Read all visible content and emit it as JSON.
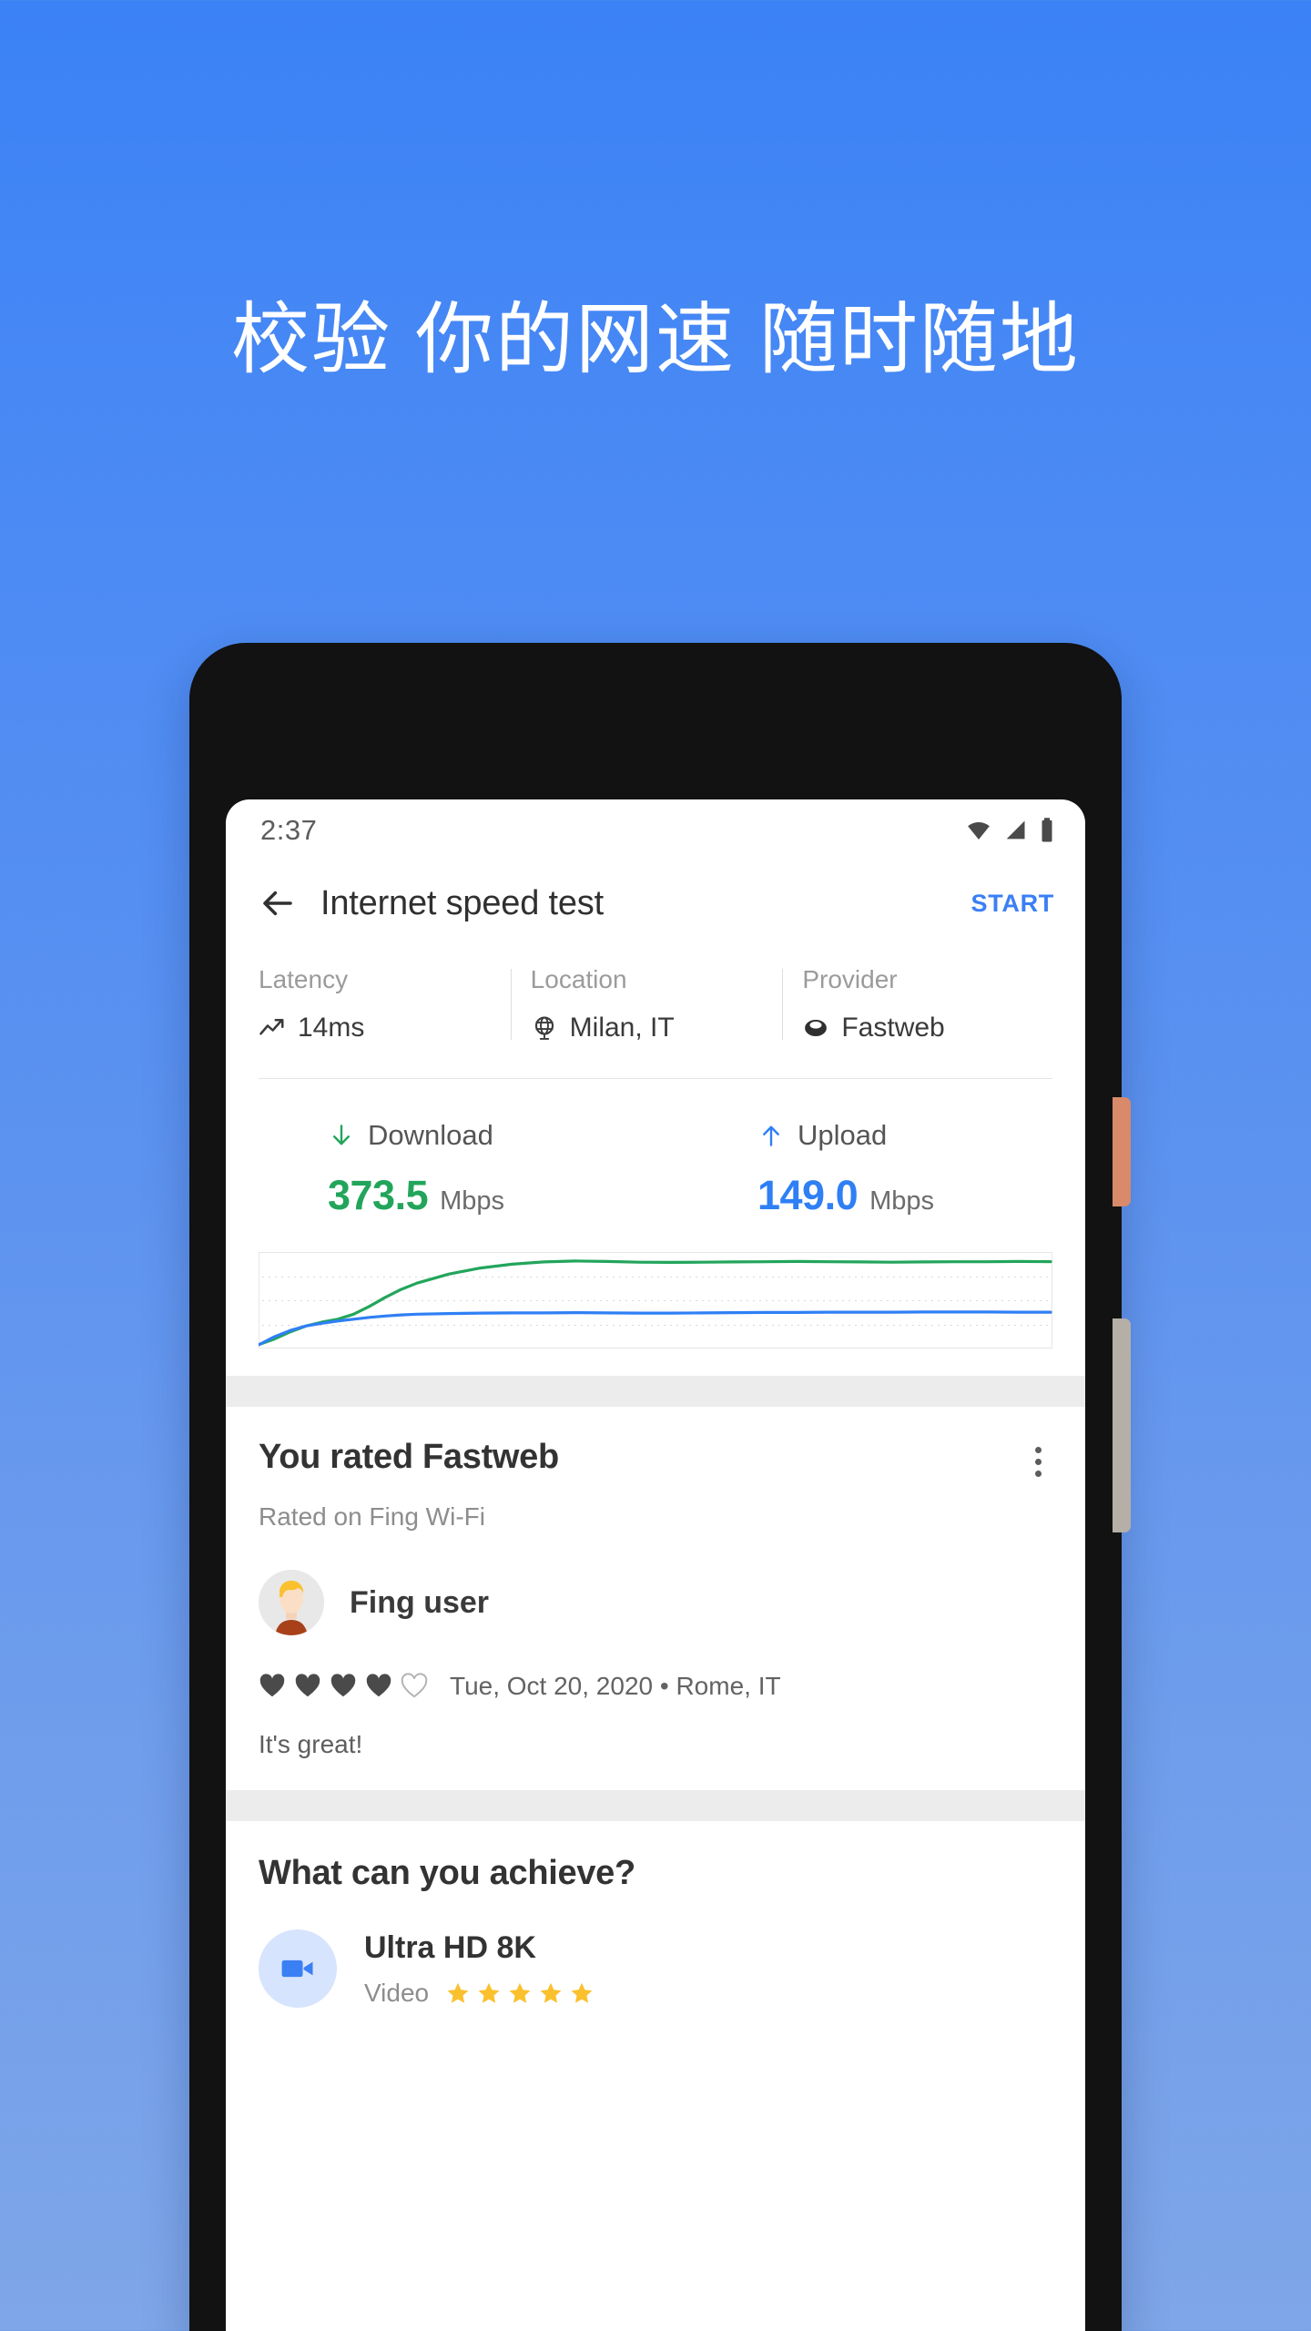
{
  "headline": "校验 你的网速 随时随地",
  "phone": {
    "power_button": "power-button",
    "volume_button": "volume-rocker"
  },
  "status_bar": {
    "time": "2:37",
    "icons": [
      "wifi-icon",
      "cellular-signal-icon",
      "battery-icon"
    ]
  },
  "appbar": {
    "back_icon": "back-arrow-icon",
    "title": "Internet speed test",
    "start_label": "START"
  },
  "info_strip": [
    {
      "label": "Latency",
      "value": "14ms",
      "icon": "trend-up-icon"
    },
    {
      "label": "Location",
      "value": "Milan, IT",
      "icon": "globe-icon"
    },
    {
      "label": "Provider",
      "value": "Fastweb",
      "icon": "server-icon"
    }
  ],
  "speeds": {
    "download": {
      "label": "Download",
      "value": "373.5",
      "unit": "Mbps",
      "color": "#22a55b",
      "icon": "arrow-down-icon"
    },
    "upload": {
      "label": "Upload",
      "value": "149.0",
      "unit": "Mbps",
      "color": "#2f7ff5",
      "icon": "arrow-up-icon"
    }
  },
  "chart_data": {
    "type": "line",
    "title": "",
    "xlabel": "",
    "ylabel": "",
    "grid": true,
    "gridlines": 3,
    "legend": "none",
    "xlim": [
      0,
      100
    ],
    "ylim": [
      0,
      400
    ],
    "series": [
      {
        "name": "Download",
        "color": "#22a55b",
        "unit": "Mbps",
        "x": [
          0,
          2,
          4,
          6,
          8,
          10,
          12,
          14,
          16,
          18,
          20,
          24,
          28,
          32,
          36,
          40,
          44,
          48,
          52,
          56,
          60,
          64,
          68,
          72,
          76,
          80,
          84,
          88,
          92,
          96,
          100
        ],
        "values": [
          5,
          30,
          62,
          88,
          105,
          118,
          140,
          175,
          215,
          250,
          278,
          318,
          345,
          362,
          372,
          376,
          374,
          371,
          370,
          371,
          372,
          373,
          374,
          373,
          372,
          371,
          372,
          373,
          373,
          374,
          373.5
        ]
      },
      {
        "name": "Upload",
        "color": "#2f7ff5",
        "unit": "Mbps",
        "x": [
          0,
          2,
          4,
          6,
          8,
          10,
          12,
          14,
          16,
          18,
          20,
          24,
          28,
          32,
          36,
          40,
          44,
          48,
          52,
          56,
          60,
          64,
          68,
          72,
          76,
          80,
          84,
          88,
          92,
          96,
          100
        ],
        "values": [
          4,
          40,
          68,
          88,
          100,
          110,
          118,
          126,
          132,
          137,
          140,
          143,
          145,
          146,
          146,
          147,
          146,
          145,
          145,
          146,
          147,
          148,
          148,
          149,
          149,
          149,
          150,
          150,
          150,
          149,
          149.0
        ]
      }
    ]
  },
  "rating_card": {
    "title": "You rated Fastweb",
    "subtitle": "Rated on Fing Wi-Fi",
    "menu_icon": "overflow-menu-icon",
    "user_name": "Fing user",
    "avatar": "user-avatar",
    "hearts_filled": 4,
    "hearts_total": 5,
    "meta": "Tue, Oct 20, 2020 • Rome, IT",
    "comment": "It's great!"
  },
  "achieve_card": {
    "title": "What can you achieve?",
    "items": [
      {
        "name": "Ultra HD 8K",
        "kind": "Video",
        "icon": "video-camera-icon",
        "stars_filled": 5,
        "stars_total": 5
      }
    ]
  },
  "colors": {
    "background_top": "#3b82f6",
    "background_bottom": "#7ea6e8",
    "accent_blue": "#3b7ff5",
    "download_green": "#22a55b",
    "upload_blue": "#2f7ff5",
    "star_gold": "#fbc02d",
    "separator_gray": "#ececec"
  }
}
